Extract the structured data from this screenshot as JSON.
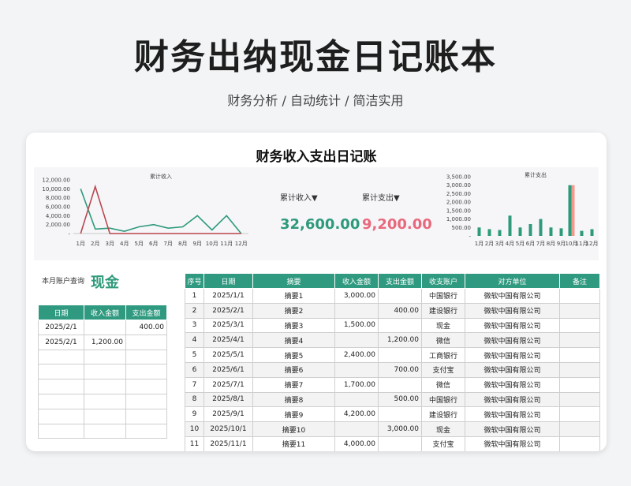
{
  "hero": {
    "title": "财务出纳现金日记账本",
    "subtitle": "财务分析 / 自动统计 / 简洁实用"
  },
  "card": {
    "title": "财务收入支出日记账"
  },
  "summary": {
    "income_label": "累计收入▼",
    "income_value": "32,600.00",
    "income_color": "#2e9a7a",
    "expense_label": "累计支出▼",
    "expense_value": "9,200.00",
    "expense_color": "#e8697d"
  },
  "chart_data": [
    {
      "type": "line",
      "title": "累计收入",
      "categories": [
        "1月",
        "2月",
        "3月",
        "4月",
        "5月",
        "6月",
        "7月",
        "8月",
        "9月",
        "10月",
        "11月",
        "12月"
      ],
      "y_ticks": [
        "12,000.00",
        "10,000.00",
        "8,000.00",
        "6,000.00",
        "4,000.00",
        "2,000.00",
        "-"
      ],
      "ylim": [
        0,
        12000
      ],
      "series": [
        {
          "values": [
            10000,
            1000,
            1200,
            500,
            1500,
            2000,
            1200,
            1500,
            4000,
            800,
            4000,
            0
          ],
          "color": "#2e9a7a"
        },
        {
          "values": [
            0,
            10500,
            0,
            0,
            0,
            0,
            0,
            0,
            0,
            0,
            0,
            0
          ],
          "color": "#b8474e"
        }
      ],
      "legend": "none"
    },
    {
      "type": "bar",
      "title": "累计支出",
      "categories": [
        "1月",
        "2月",
        "3月",
        "4月",
        "5月",
        "6月",
        "7月",
        "8月",
        "9月",
        "10月",
        "11月",
        "12月"
      ],
      "y_ticks": [
        "3,500.00",
        "3,000.00",
        "2,500.00",
        "2,000.00",
        "1,500.00",
        "1,000.00",
        "500.00",
        "-"
      ],
      "ylim": [
        0,
        3500
      ],
      "series": [
        {
          "values": [
            500,
            400,
            350,
            1200,
            500,
            700,
            1000,
            500,
            450,
            3000,
            300,
            400
          ],
          "color": "#2e9a7a"
        },
        {
          "values": [
            0,
            0,
            0,
            0,
            0,
            0,
            0,
            0,
            0,
            3000,
            0,
            0
          ],
          "color": "#f4998c"
        }
      ],
      "legend": "none"
    }
  ],
  "query": {
    "label": "本月账户查询",
    "value": "现金"
  },
  "side_table": {
    "headers": [
      "日期",
      "收入金额",
      "支出金额"
    ],
    "rows": [
      [
        "2025/2/1",
        "",
        "400.00"
      ],
      [
        "2025/2/1",
        "1,200.00",
        ""
      ],
      [
        "",
        "",
        ""
      ],
      [
        "",
        "",
        ""
      ],
      [
        "",
        "",
        ""
      ],
      [
        "",
        "",
        ""
      ],
      [
        "",
        "",
        ""
      ],
      [
        "",
        "",
        ""
      ]
    ]
  },
  "main_table": {
    "headers": [
      "序号",
      "日期",
      "摘要",
      "收入金额",
      "支出金额",
      "收支账户",
      "对方单位",
      "备注"
    ],
    "rows": [
      [
        "1",
        "2025/1/1",
        "摘要1",
        "3,000.00",
        "",
        "中国银行",
        "微软中国有限公司",
        ""
      ],
      [
        "2",
        "2025/2/1",
        "摘要2",
        "",
        "400.00",
        "建设银行",
        "微软中国有限公司",
        ""
      ],
      [
        "3",
        "2025/3/1",
        "摘要3",
        "1,500.00",
        "",
        "现金",
        "微软中国有限公司",
        ""
      ],
      [
        "4",
        "2025/4/1",
        "摘要4",
        "",
        "1,200.00",
        "微信",
        "微软中国有限公司",
        ""
      ],
      [
        "5",
        "2025/5/1",
        "摘要5",
        "2,400.00",
        "",
        "工商银行",
        "微软中国有限公司",
        ""
      ],
      [
        "6",
        "2025/6/1",
        "摘要6",
        "",
        "700.00",
        "支付宝",
        "微软中国有限公司",
        ""
      ],
      [
        "7",
        "2025/7/1",
        "摘要7",
        "1,700.00",
        "",
        "微信",
        "微软中国有限公司",
        ""
      ],
      [
        "8",
        "2025/8/1",
        "摘要8",
        "",
        "500.00",
        "中国银行",
        "微软中国有限公司",
        ""
      ],
      [
        "9",
        "2025/9/1",
        "摘要9",
        "4,200.00",
        "",
        "建设银行",
        "微软中国有限公司",
        ""
      ],
      [
        "10",
        "2025/10/1",
        "摘要10",
        "",
        "3,000.00",
        "现金",
        "微软中国有限公司",
        ""
      ],
      [
        "11",
        "2025/11/1",
        "摘要11",
        "4,000.00",
        "",
        "支付宝",
        "微软中国有限公司",
        ""
      ]
    ]
  }
}
